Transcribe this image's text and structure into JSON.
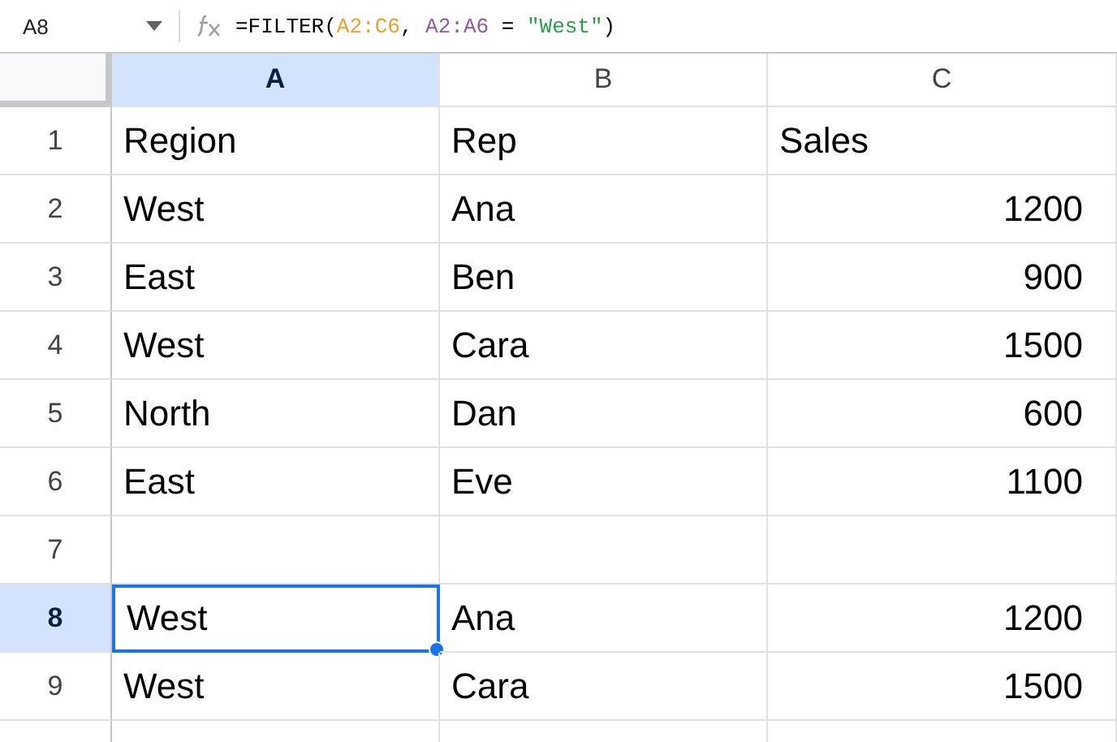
{
  "formula_bar": {
    "name_box": "A8",
    "formula": [
      {
        "text": "=FILTER(",
        "color": "#000000"
      },
      {
        "text": "A2:C6",
        "color": "#f0a030"
      },
      {
        "text": ", ",
        "color": "#000000"
      },
      {
        "text": "A2:A6",
        "color": "#8e5ba6"
      },
      {
        "text": " = ",
        "color": "#000000"
      },
      {
        "text": "\"West\"",
        "color": "#2e9e4a"
      },
      {
        "text": ")",
        "color": "#000000"
      }
    ]
  },
  "columns": [
    {
      "label": "A",
      "selected": true
    },
    {
      "label": "B",
      "selected": false
    },
    {
      "label": "C",
      "selected": false
    }
  ],
  "rows": [
    {
      "number": "1",
      "selected": false,
      "cells": [
        {
          "text": "Region",
          "kind": "text"
        },
        {
          "text": "Rep",
          "kind": "text"
        },
        {
          "text": "Sales",
          "kind": "text"
        }
      ]
    },
    {
      "number": "2",
      "selected": false,
      "cells": [
        {
          "text": "West",
          "kind": "text"
        },
        {
          "text": "Ana",
          "kind": "text"
        },
        {
          "text": "1200",
          "kind": "number"
        }
      ]
    },
    {
      "number": "3",
      "selected": false,
      "cells": [
        {
          "text": "East",
          "kind": "text"
        },
        {
          "text": "Ben",
          "kind": "text"
        },
        {
          "text": "900",
          "kind": "number"
        }
      ]
    },
    {
      "number": "4",
      "selected": false,
      "cells": [
        {
          "text": "West",
          "kind": "text"
        },
        {
          "text": "Cara",
          "kind": "text"
        },
        {
          "text": "1500",
          "kind": "number"
        }
      ]
    },
    {
      "number": "5",
      "selected": false,
      "cells": [
        {
          "text": "North",
          "kind": "text"
        },
        {
          "text": "Dan",
          "kind": "text"
        },
        {
          "text": "600",
          "kind": "number"
        }
      ]
    },
    {
      "number": "6",
      "selected": false,
      "cells": [
        {
          "text": "East",
          "kind": "text"
        },
        {
          "text": "Eve",
          "kind": "text"
        },
        {
          "text": "1100",
          "kind": "number"
        }
      ]
    },
    {
      "number": "7",
      "selected": false
    },
    {
      "number": "8",
      "selected": true,
      "cells": [
        {
          "text": "West",
          "kind": "text"
        },
        {
          "text": "Ana",
          "kind": "text"
        },
        {
          "text": "1200",
          "kind": "number"
        }
      ]
    },
    {
      "number": "9",
      "selected": false,
      "cells": [
        {
          "text": "West",
          "kind": "text"
        },
        {
          "text": "Cara",
          "kind": "text"
        },
        {
          "text": "1500",
          "kind": "number"
        }
      ]
    }
  ]
}
